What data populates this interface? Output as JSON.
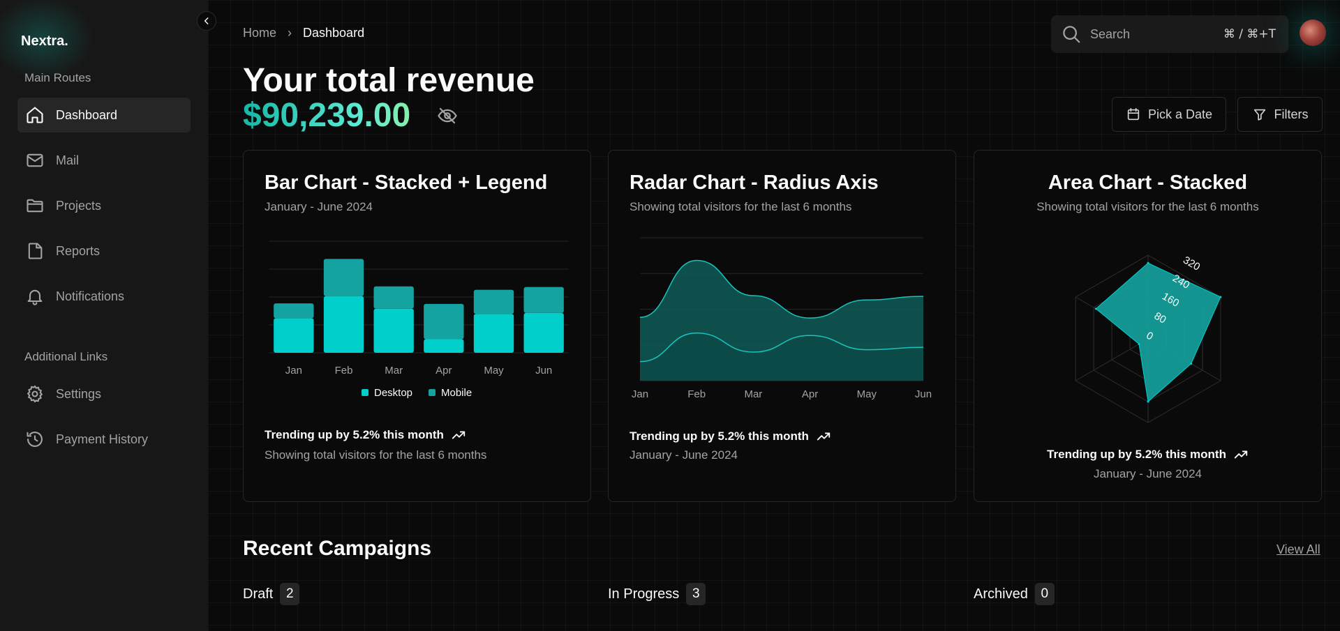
{
  "app": {
    "brand": "Nextra."
  },
  "sidebar": {
    "main_label": "Main Routes",
    "main_items": [
      {
        "label": "Dashboard",
        "icon": "home-icon",
        "active": true
      },
      {
        "label": "Mail",
        "icon": "mail-icon"
      },
      {
        "label": "Projects",
        "icon": "folder-icon"
      },
      {
        "label": "Reports",
        "icon": "file-icon"
      },
      {
        "label": "Notifications",
        "icon": "bell-icon"
      }
    ],
    "additional_label": "Additional Links",
    "additional_items": [
      {
        "label": "Settings",
        "icon": "gear-icon"
      },
      {
        "label": "Payment History",
        "icon": "history-icon"
      }
    ]
  },
  "breadcrumb": {
    "home": "Home",
    "separator": "›",
    "current": "Dashboard"
  },
  "search": {
    "placeholder": "Search",
    "shortcut": "⌘ / ⌘+T"
  },
  "header": {
    "title": "Your total revenue",
    "revenue": "$90,239.00"
  },
  "actions": {
    "pick_date": "Pick a Date",
    "filters": "Filters"
  },
  "colors": {
    "accent": "#00cfcc",
    "accent_dark": "#14a3a0",
    "area_fill": "#0f5a57"
  },
  "cards": {
    "bar": {
      "title": "Bar Chart - Stacked + Legend",
      "subtitle": "January - June 2024",
      "trend": "Trending up by 5.2% this month",
      "footer": "Showing total visitors for the last 6 months"
    },
    "area": {
      "title": "Radar Chart - Radius Axis",
      "subtitle": "Showing total visitors for the last 6 months",
      "trend": "Trending up by 5.2% this month",
      "footer": "January - June 2024"
    },
    "radar": {
      "title": "Area Chart - Stacked",
      "subtitle": "Showing total visitors for the last 6 months",
      "trend": "Trending up by 5.2% this month",
      "footer": "January - June 2024"
    }
  },
  "chart_data": [
    {
      "type": "bar",
      "stacked": true,
      "categories": [
        "Jan",
        "Feb",
        "Mar",
        "Apr",
        "May",
        "Jun"
      ],
      "series": [
        {
          "name": "Desktop",
          "values": [
            186,
            305,
            237,
            73,
            209,
            214
          ]
        },
        {
          "name": "Mobile",
          "values": [
            80,
            200,
            120,
            190,
            130,
            140
          ]
        }
      ],
      "ylim": [
        0,
        600
      ],
      "grid": true,
      "legend": "bottom"
    },
    {
      "type": "area",
      "stacked": true,
      "x": [
        "Jan",
        "Feb",
        "Mar",
        "Apr",
        "May",
        "Jun"
      ],
      "series": [
        {
          "values": [
            80,
            200,
            120,
            190,
            130,
            140
          ]
        },
        {
          "values": [
            186,
            305,
            237,
            73,
            209,
            214
          ]
        }
      ],
      "ylim": [
        0,
        600
      ],
      "grid": true
    },
    {
      "type": "radar",
      "categories": [
        "",
        "",
        "",
        "",
        "",
        ""
      ],
      "values": [
        290,
        320,
        190,
        240,
        40,
        230
      ],
      "radial_ticks": [
        "0",
        "80",
        "160",
        "240",
        "320"
      ],
      "rlim": [
        0,
        320
      ]
    }
  ],
  "campaigns": {
    "title": "Recent Campaigns",
    "view_all": "View All",
    "statuses": [
      {
        "label": "Draft",
        "count": "2"
      },
      {
        "label": "In Progress",
        "count": "3"
      },
      {
        "label": "Archived",
        "count": "0"
      }
    ]
  }
}
